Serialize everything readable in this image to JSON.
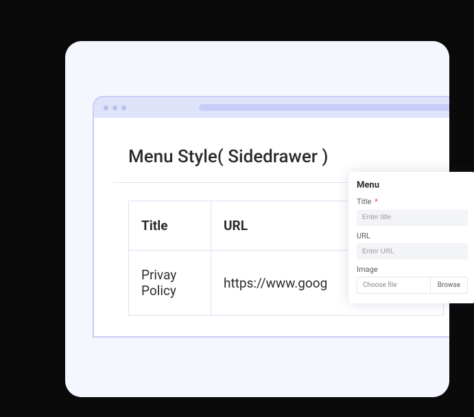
{
  "card": {
    "title": "Menu Style( Sidedrawer )",
    "table": {
      "columns": [
        "Title",
        "URL"
      ],
      "rows": [
        {
          "title": "Privay Policy",
          "url": "https://www.goog"
        }
      ]
    }
  },
  "panel": {
    "heading": "Menu",
    "fields": {
      "title_label": "Title",
      "title_required": "*",
      "title_placeholder": "Enter title",
      "url_label": "URL",
      "url_placeholder": "Enter URL",
      "image_label": "Image",
      "file_choose": "Choose file",
      "file_browse": "Browse"
    }
  }
}
